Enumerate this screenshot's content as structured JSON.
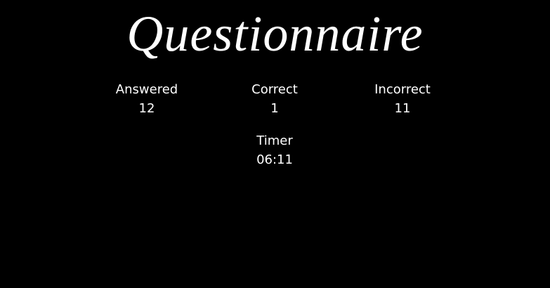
{
  "title": "Questionnaire",
  "stats": {
    "answered": {
      "label": "Answered",
      "value": "12"
    },
    "correct": {
      "label": "Correct",
      "value": "1"
    },
    "incorrect": {
      "label": "Incorrect",
      "value": "11"
    }
  },
  "timer": {
    "label": "Timer",
    "value": "06:11"
  },
  "colors": {
    "background": "#000000",
    "text": "#ffffff"
  }
}
